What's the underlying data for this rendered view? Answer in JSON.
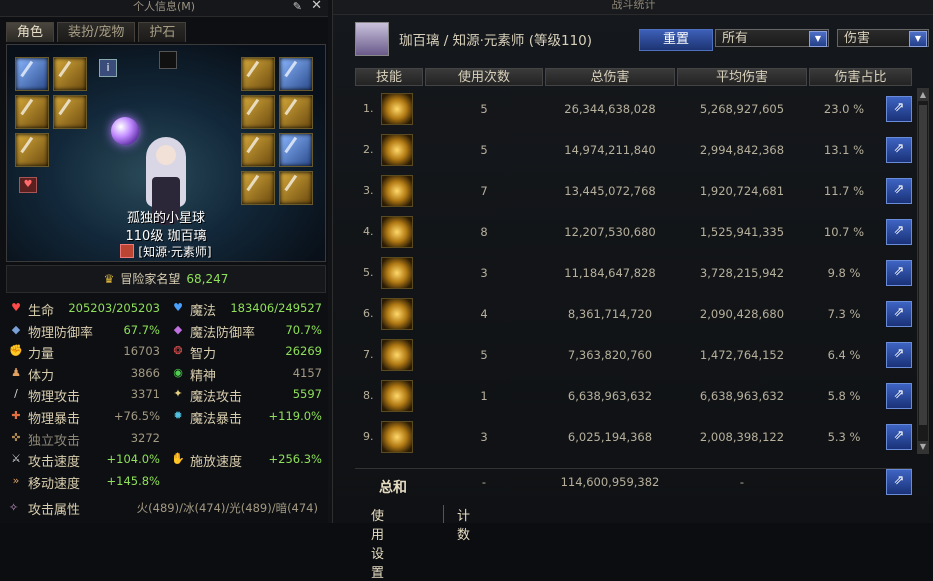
{
  "left_panel": {
    "title": "个人信息(M)",
    "tabs": [
      "角色",
      "装扮/宠物",
      "护石"
    ],
    "character_title": "孤独的小星球",
    "level_line": "110级 珈百璃",
    "job_line": "[知源·元素师]",
    "fame_label": "冒险家名望",
    "fame_value": "68,247",
    "stats": [
      {
        "left": {
          "k": "生命",
          "v": "205203/205203",
          "green": true,
          "icon": "heart-icon",
          "ic": "♥",
          "icolor": "#ff4a4a"
        },
        "right": {
          "k": "魔法",
          "v": "183406/249527",
          "green": true,
          "icon": "mana-icon",
          "ic": "♥",
          "icolor": "#4aa0ff"
        }
      },
      {
        "left": {
          "k": "物理防御率",
          "v": "67.7%",
          "green": true,
          "icon": "shield-icon",
          "ic": "◆",
          "icolor": "#7aa0d8"
        },
        "right": {
          "k": "魔法防御率",
          "v": "70.7%",
          "green": true,
          "icon": "magic-shield-icon",
          "ic": "◆",
          "icolor": "#c070e0"
        }
      },
      {
        "left": {
          "k": "力量",
          "v": "16703",
          "green": false,
          "icon": "strength-icon",
          "ic": "✊",
          "icolor": "#e0a060"
        },
        "right": {
          "k": "智力",
          "v": "26269",
          "green": true,
          "icon": "intelligence-icon",
          "ic": "❂",
          "icolor": "#e05050"
        }
      },
      {
        "left": {
          "k": "体力",
          "v": "3866",
          "green": false,
          "icon": "vitality-icon",
          "ic": "♟",
          "icolor": "#e0a060"
        },
        "right": {
          "k": "精神",
          "v": "4157",
          "green": false,
          "icon": "spirit-icon",
          "ic": "◉",
          "icolor": "#50d050"
        }
      },
      {
        "left": {
          "k": "物理攻击",
          "v": "3371",
          "green": false,
          "icon": "sword-icon",
          "ic": "/",
          "icolor": "#d8d8d8"
        },
        "right": {
          "k": "魔法攻击",
          "v": "5597",
          "green": true,
          "icon": "magic-attack-icon",
          "ic": "✦",
          "icolor": "#e8d080"
        }
      },
      {
        "left": {
          "k": "物理暴击",
          "v": "+76.5%",
          "green": false,
          "icon": "crit-icon",
          "ic": "✚",
          "icolor": "#e07040"
        },
        "right": {
          "k": "魔法暴击",
          "v": "+119.0%",
          "green": true,
          "icon": "magic-crit-icon",
          "ic": "✹",
          "icolor": "#50c0e0"
        }
      },
      {
        "left": {
          "k": "独立攻击",
          "v": "3272",
          "green": false,
          "dim": true,
          "icon": "independent-attack-icon",
          "ic": "✜",
          "icolor": "#b08a50"
        },
        "right": null
      },
      {
        "left": {
          "k": "攻击速度",
          "v": "+104.0%",
          "green": true,
          "icon": "attack-speed-icon",
          "ic": "⚔",
          "icolor": "#d8d8d8"
        },
        "right": {
          "k": "施放速度",
          "v": "+256.3%",
          "green": true,
          "icon": "cast-speed-icon",
          "ic": "✋",
          "icolor": "#80c060"
        }
      },
      {
        "left": {
          "k": "移动速度",
          "v": "+145.8%",
          "green": true,
          "icon": "move-speed-icon",
          "ic": "»",
          "icolor": "#e0a060"
        },
        "right": null
      }
    ],
    "attack_attr_label": "攻击属性",
    "attack_attr_value": "火(489)/冰(474)/光(489)/暗(474)"
  },
  "right_panel": {
    "title": "战斗统计",
    "header_name": "珈百璃 / 知源·元素师 (等级110)",
    "reset_label": "重置",
    "filter1": "所有",
    "filter2": "伤害",
    "columns": [
      "技能",
      "使用次数",
      "总伤害",
      "平均伤害",
      "伤害占比"
    ],
    "rows": [
      {
        "idx": "1.",
        "uses": "5",
        "total": "26,344,638,028",
        "avg": "5,268,927,605",
        "pct": "23.0 %"
      },
      {
        "idx": "2.",
        "uses": "5",
        "total": "14,974,211,840",
        "avg": "2,994,842,368",
        "pct": "13.1 %"
      },
      {
        "idx": "3.",
        "uses": "7",
        "total": "13,445,072,768",
        "avg": "1,920,724,681",
        "pct": "11.7 %"
      },
      {
        "idx": "4.",
        "uses": "8",
        "total": "12,207,530,680",
        "avg": "1,525,941,335",
        "pct": "10.7 %"
      },
      {
        "idx": "5.",
        "uses": "3",
        "total": "11,184,647,828",
        "avg": "3,728,215,942",
        "pct": "9.8 %"
      },
      {
        "idx": "6.",
        "uses": "4",
        "total": "8,361,714,720",
        "avg": "2,090,428,680",
        "pct": "7.3 %"
      },
      {
        "idx": "7.",
        "uses": "5",
        "total": "7,363,820,760",
        "avg": "1,472,764,152",
        "pct": "6.4 %"
      },
      {
        "idx": "8.",
        "uses": "1",
        "total": "6,638,963,632",
        "avg": "6,638,963,632",
        "pct": "5.8 %"
      },
      {
        "idx": "9.",
        "uses": "3",
        "total": "6,025,194,368",
        "avg": "2,008,398,122",
        "pct": "5.3 %"
      }
    ],
    "total_label": "总和",
    "total_uses": "-",
    "total_damage": "114,600,959,382",
    "total_avg": "-",
    "bottom_tabs": [
      "使用设置",
      "计数"
    ]
  }
}
